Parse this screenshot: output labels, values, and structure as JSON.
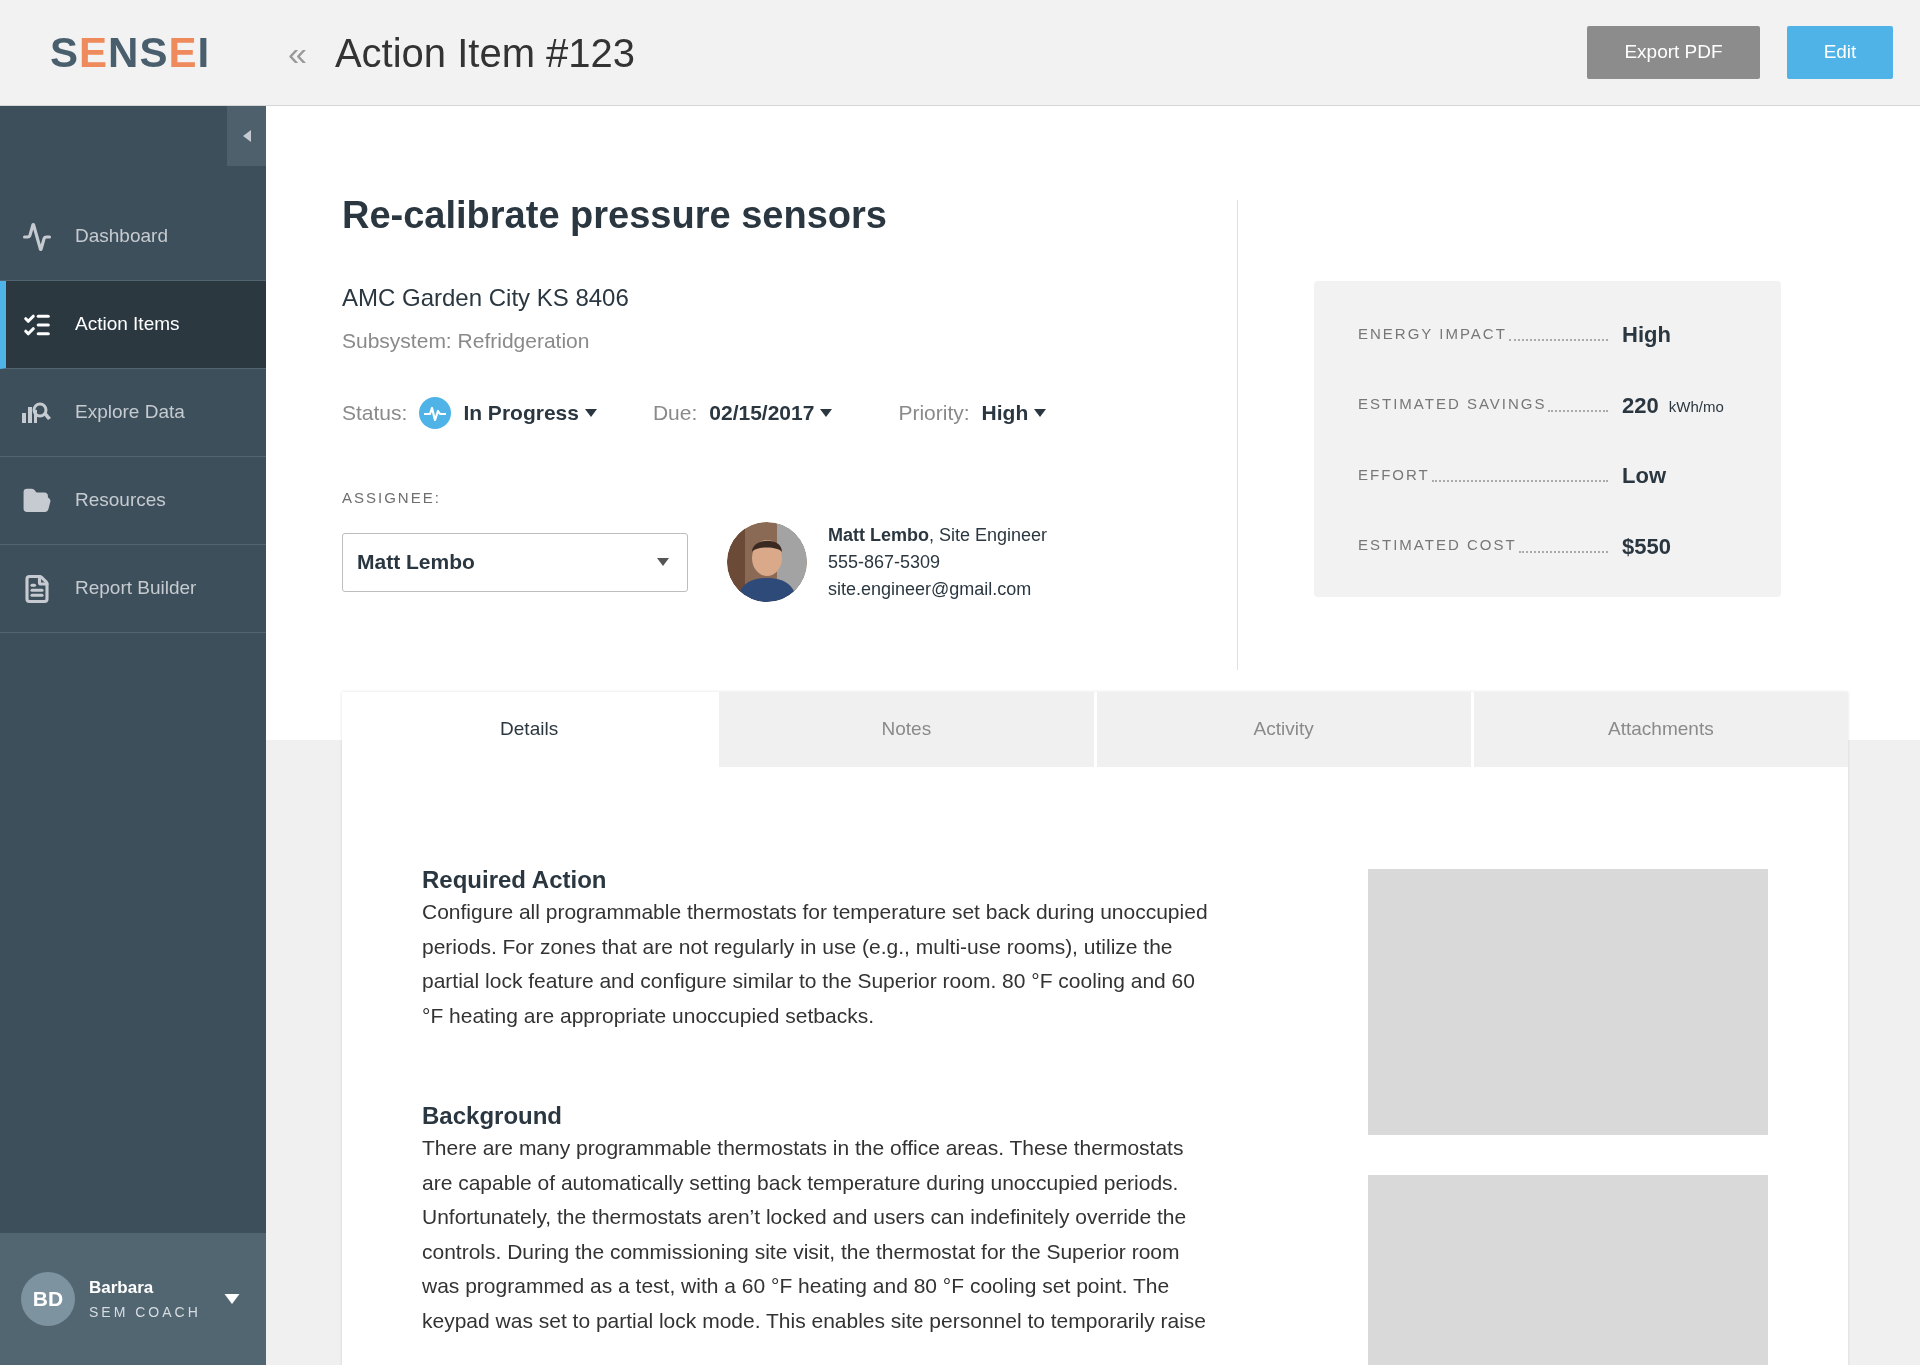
{
  "logo": [
    {
      "text": "S",
      "accent": false
    },
    {
      "text": "E",
      "accent": true
    },
    {
      "text": "N",
      "accent": false
    },
    {
      "text": "S",
      "accent": false
    },
    {
      "text": "E",
      "accent": true
    },
    {
      "text": "I",
      "accent": false
    }
  ],
  "header": {
    "back": "«",
    "title": "Action Item #123",
    "buttons": [
      {
        "label": "Export PDF",
        "kind": "secondary"
      },
      {
        "label": "Edit",
        "kind": "primary"
      }
    ]
  },
  "sidebar": {
    "items": [
      {
        "label": "Dashboard",
        "selected": false
      },
      {
        "label": "Action Items",
        "selected": true
      },
      {
        "label": "Explore Data",
        "selected": false
      },
      {
        "label": "Resources",
        "selected": false
      },
      {
        "label": "Report Builder",
        "selected": false
      }
    ],
    "user": {
      "initials": "BD",
      "name": "Barbara",
      "role": "SEM COACH"
    }
  },
  "item": {
    "title": "Re-calibrate pressure sensors",
    "site": "AMC Garden City KS 8406",
    "subsystem": "Subsystem: Refridgeration",
    "fields": [
      {
        "label": "Status:",
        "value": "In Progress",
        "kind": "status"
      },
      {
        "label": "Due:",
        "value": "02/15/2017",
        "kind": "plain"
      },
      {
        "label": "Priority:",
        "value": "High",
        "kind": "plain"
      }
    ],
    "assignee": {
      "label": "ASSIGNEE:",
      "value": "Matt Lembo",
      "contact_name": "Matt Lembo",
      "contact_role": ", Site Engineer",
      "phone": "555-867-5309",
      "email": "site.engineer@gmail.com"
    }
  },
  "metrics": [
    {
      "label": "ENERGY IMPACT",
      "value": "High"
    },
    {
      "label": "ESTIMATED SAVINGS",
      "value": "220",
      "unit": "kWh/mo"
    },
    {
      "label": "EFFORT",
      "value": "Low"
    },
    {
      "label": "ESTIMATED COST",
      "value": "$550"
    }
  ],
  "tabs": [
    {
      "label": "Details",
      "selected": true
    },
    {
      "label": "Notes",
      "selected": false
    },
    {
      "label": "Activity",
      "selected": false
    },
    {
      "label": "Attachments",
      "selected": false
    }
  ],
  "sections": [
    {
      "heading": "Required Action",
      "text": "Configure all programmable thermostats for temperature set back during unoccupied periods. For zones that are not regularly in use (e.g., multi-use rooms), utilize the partial lock feature and configure similar to the Superior room. 80 °F cooling and 60 °F heating are appropriate unoccupied setbacks."
    },
    {
      "heading": "Background",
      "text": "There are many programmable thermostats in the office areas. These thermostats are capable of automatically setting back temperature during unoccupied periods. Unfortunately, the thermostats aren’t locked and users can indefinitely override the controls. During the commissioning site visit, the thermostat for the Superior room was programmed as a test, with a 60 °F heating and 80 °F cooling set point. The keypad was set to partial lock mode. This enables site personnel to temporarily raise"
    }
  ]
}
